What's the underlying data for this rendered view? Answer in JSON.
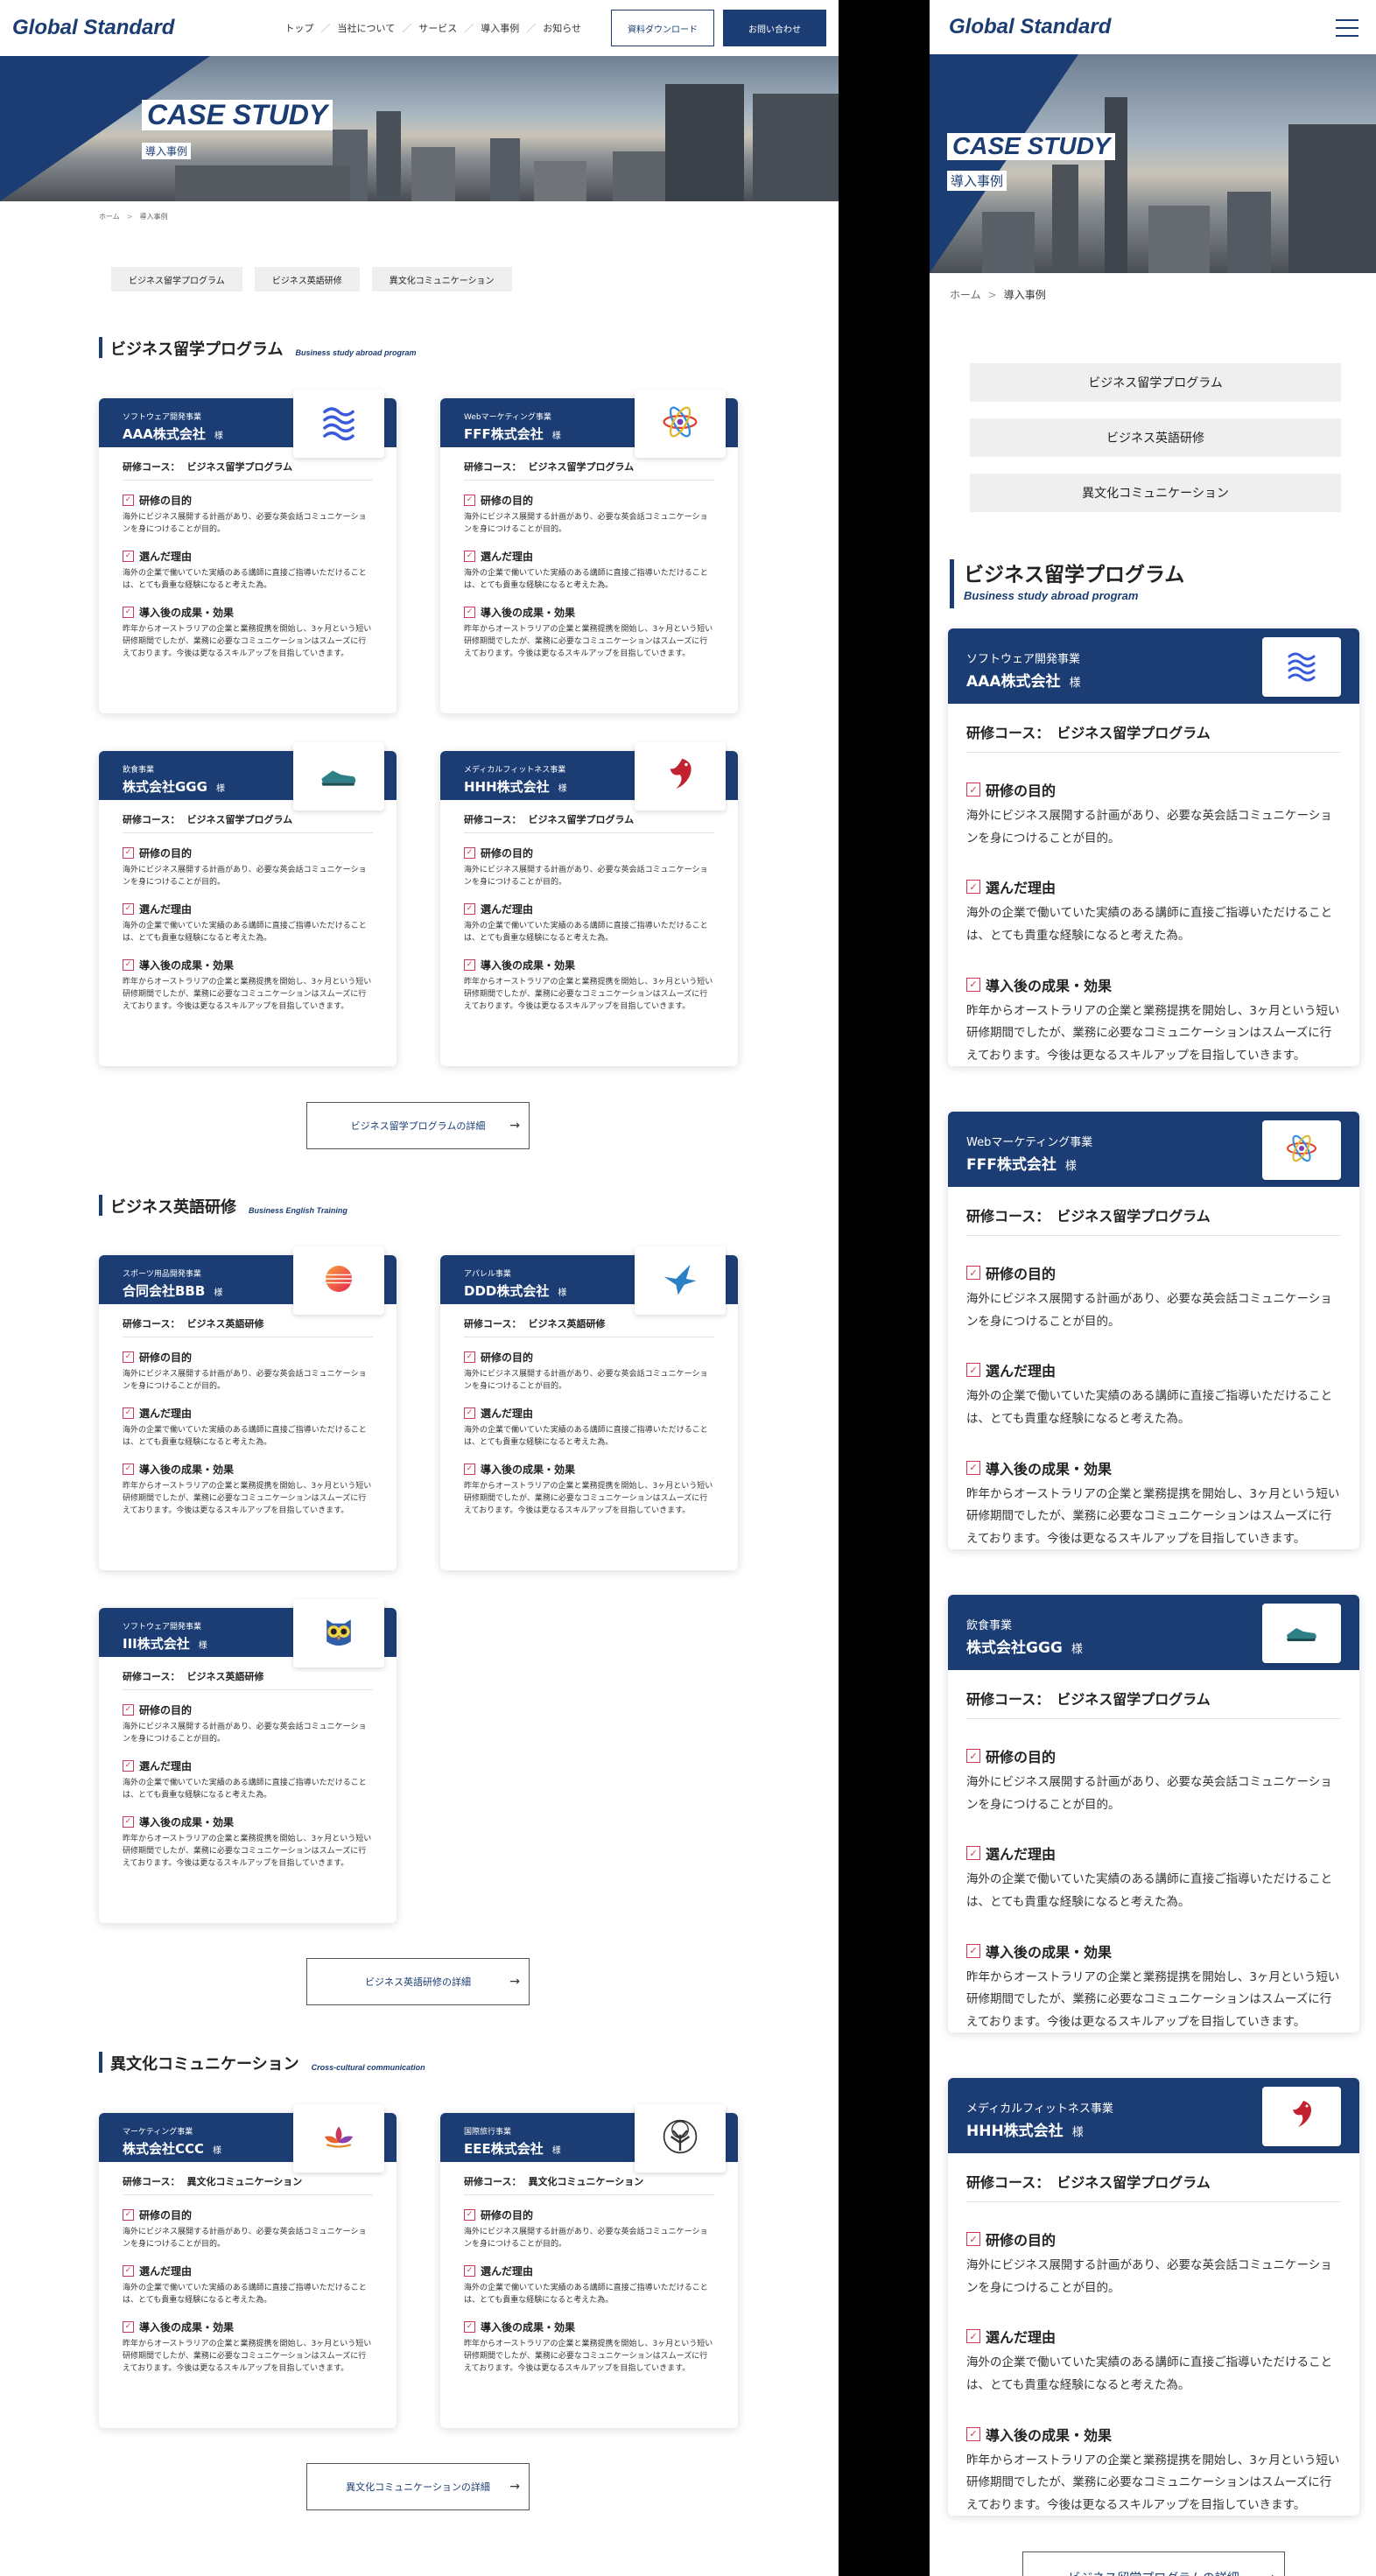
{
  "site": {
    "logo": "Global Standard",
    "nav": [
      "トップ",
      "当社について",
      "サービス",
      "導入事例",
      "お知らせ"
    ],
    "nav_sep": "／",
    "download_label": "資料ダウンロード",
    "contact_label": "お問い合わせ",
    "menu_icon": "hamburger-icon"
  },
  "hero": {
    "title": "CASE STUDY",
    "subtitle": "導入事例"
  },
  "breadcrumb": {
    "home": "ホーム",
    "sep": ">",
    "current": "導入事例"
  },
  "tabs": [
    "ビジネス留学プログラム",
    "ビジネス英語研修",
    "異文化コミュニケーション"
  ],
  "labels": {
    "sama": "様",
    "course_prefix": "研修コース：",
    "purpose": "研修の目的",
    "reason": "選んだ理由",
    "result": "導入後の成果・効果",
    "purpose_text": "海外にビジネス展開する計画があり、必要な英会話コミュニケーションを身につけることが目的。",
    "reason_text": "海外の企業で働いていた実績のある講師に直接ご指導いただけることは、とても貴重な経験になると考えた為。",
    "result_text": "昨年からオーストラリアの企業と業務提携を開始し、3ヶ月という短い研修期間でしたが、業務に必要なコミュニケーションはスムーズに行えております。今後は更なるスキルアップを目指していきます。",
    "check_glyph": "✓",
    "arrow_glyph": "→"
  },
  "sections": [
    {
      "title": "ビジネス留学プログラム",
      "en": "Business study abroad program",
      "button": "ビジネス留学プログラムの詳細",
      "cards": [
        {
          "industry": "ソフトウェア開発事業",
          "company": "AAA株式会社",
          "course": "ビジネス留学プログラム",
          "logo": "waves-logo-icon"
        },
        {
          "industry": "Webマーケティング事業",
          "company": "FFF株式会社",
          "course": "ビジネス留学プログラム",
          "logo": "atom-logo-icon"
        },
        {
          "industry": "飲食事業",
          "company": "株式会社GGG",
          "course": "ビジネス留学プログラム",
          "logo": "shoe-logo-icon"
        },
        {
          "industry": "メディカルフィットネス事業",
          "company": "HHH株式会社",
          "course": "ビジネス留学プログラム",
          "logo": "dragon-logo-icon"
        }
      ]
    },
    {
      "title": "ビジネス英語研修",
      "en": "Business English Training",
      "button": "ビジネス英語研修の詳細",
      "cards": [
        {
          "industry": "スポーツ用品開発事業",
          "company": "合同会社BBB",
          "course": "ビジネス英語研修",
          "logo": "sphere-logo-icon"
        },
        {
          "industry": "アパレル事業",
          "company": "DDD株式会社",
          "course": "ビジネス英語研修",
          "logo": "bird-logo-icon"
        },
        {
          "industry": "ソフトウェア開発事業",
          "company": "III株式会社",
          "course": "ビジネス英語研修",
          "logo": "owl-logo-icon"
        }
      ]
    },
    {
      "title": "異文化コミュニケーション",
      "en": "Cross-cultural communication",
      "button": "異文化コミュニケーションの詳細",
      "cards": [
        {
          "industry": "マーケティング事業",
          "company": "株式会社CCC",
          "course": "異文化コミュニケーション",
          "logo": "lotus-logo-icon"
        },
        {
          "industry": "国際旅行事業",
          "company": "EEE株式会社",
          "course": "異文化コミュニケーション",
          "logo": "tree-logo-icon"
        }
      ]
    }
  ],
  "colors": {
    "brand": "#1b3d73",
    "check": "#c9375a",
    "tab_bg": "#efefef"
  }
}
